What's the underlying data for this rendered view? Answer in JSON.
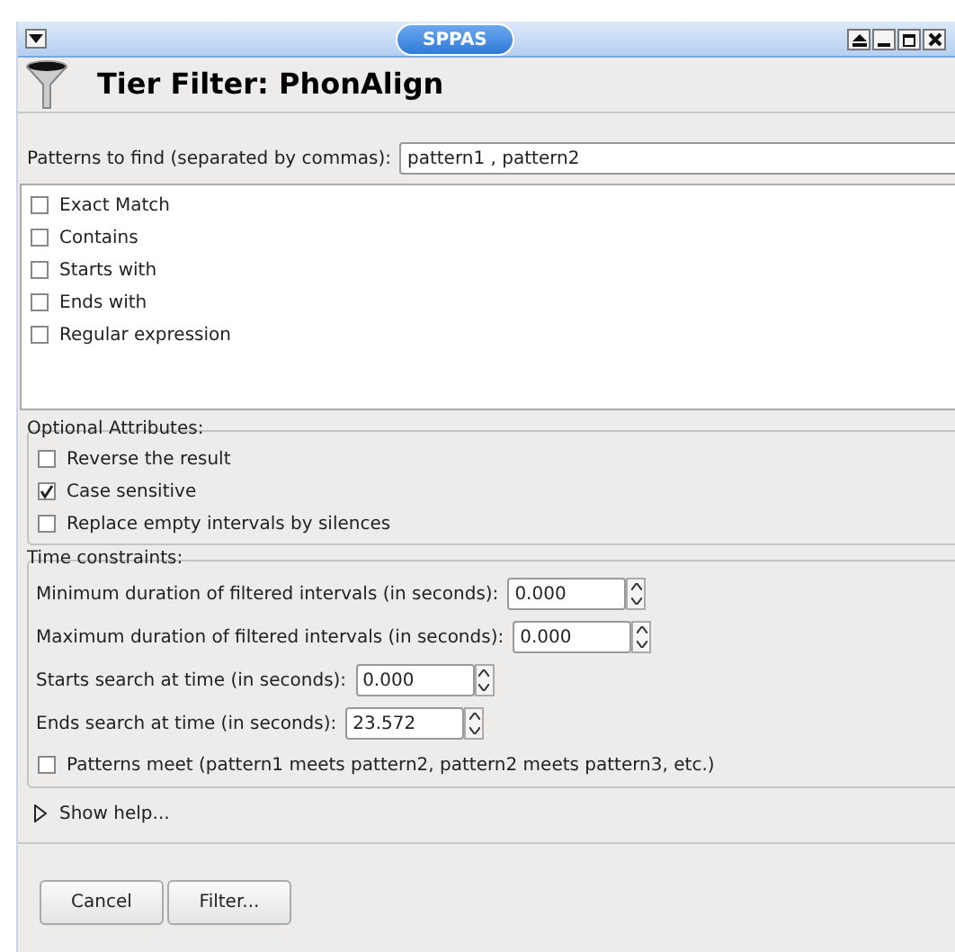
{
  "window": {
    "title": "SPPAS"
  },
  "header": {
    "title": "Tier Filter: PhonAlign"
  },
  "patterns": {
    "label": "Patterns to find (separated by commas):",
    "value": "pattern1 , pattern2"
  },
  "modes": [
    {
      "label": "Exact Match",
      "checked": false
    },
    {
      "label": "Contains",
      "checked": false
    },
    {
      "label": "Starts with",
      "checked": false
    },
    {
      "label": "Ends with",
      "checked": false
    },
    {
      "label": "Regular expression",
      "checked": false
    }
  ],
  "optional_attributes": {
    "title": "Optional Attributes:",
    "options": [
      {
        "label": "Reverse the result",
        "checked": false
      },
      {
        "label": "Case sensitive",
        "checked": true
      },
      {
        "label": "Replace empty intervals by silences",
        "checked": false
      }
    ]
  },
  "time_constraints": {
    "title": "Time constraints:",
    "fields": [
      {
        "label": "Minimum duration of filtered intervals (in seconds):",
        "value": "0.000"
      },
      {
        "label": "Maximum duration of filtered intervals (in seconds):",
        "value": "0.000"
      },
      {
        "label": "Starts search at time (in seconds):",
        "value": "0.000"
      },
      {
        "label": "Ends search at time (in seconds):",
        "value": "23.572"
      }
    ],
    "meet": {
      "label": "Patterns meet (pattern1 meets pattern2, pattern2 meets pattern3, etc.)",
      "checked": false
    }
  },
  "help": {
    "label": "Show help...",
    "expanded": false
  },
  "buttons": [
    "Cancel",
    "Filter..."
  ]
}
